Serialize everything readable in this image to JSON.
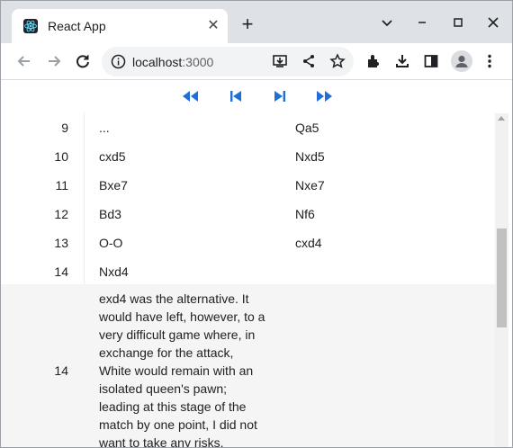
{
  "browser": {
    "tab_title": "React App",
    "tab_close": "✕",
    "new_tab": "+",
    "url_host": "localhost",
    "url_port": ":3000",
    "window_controls": {
      "menu": "⌄",
      "minimize": "▫",
      "close": "✕"
    }
  },
  "navigation": {
    "buttons": [
      "first-move",
      "previous-move",
      "next-move",
      "last-move"
    ],
    "accent_color": "#1f6fd6"
  },
  "moves": [
    {
      "number": "9",
      "white": "...",
      "black": "Qa5"
    },
    {
      "number": "10",
      "white": "cxd5",
      "black": "Nxd5"
    },
    {
      "number": "11",
      "white": "Bxe7",
      "black": "Nxe7"
    },
    {
      "number": "12",
      "white": "Bd3",
      "black": "Nf6"
    },
    {
      "number": "13",
      "white": "O-O",
      "black": "cxd4"
    },
    {
      "number": "14",
      "white": "Nxd4",
      "black": ""
    }
  ],
  "comment": {
    "number": "14",
    "lines": [
      "exd4 was the alternative. It",
      "would have left, however, to a",
      "very difficult game where, in",
      "exchange for the attack,",
      "White would remain with an",
      "isolated queen's pawn;",
      "leading at this stage of the",
      "match by one point, I did not",
      "want to take any risks."
    ]
  }
}
